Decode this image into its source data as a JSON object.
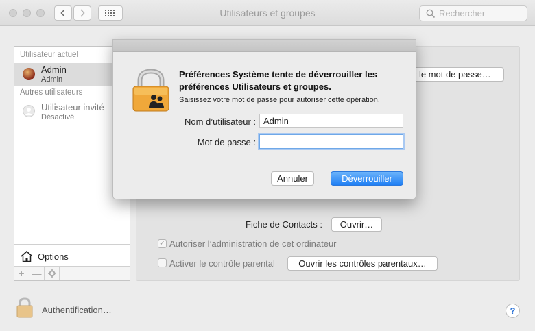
{
  "window": {
    "title": "Utilisateurs et groupes",
    "search_placeholder": "Rechercher"
  },
  "sidebar": {
    "current_user_section": "Utilisateur actuel",
    "current_user": {
      "name": "Admin",
      "role": "Admin"
    },
    "other_users_section": "Autres utilisateurs",
    "guest_user": {
      "name": "Utilisateur invité",
      "status": "Désactivé"
    },
    "options_label": "Options",
    "add_label": "+",
    "remove_label": "—"
  },
  "main": {
    "change_password_button": "r le mot de passe…",
    "contacts_card_label": "Fiche de Contacts :",
    "open_button": "Ouvrir…",
    "allow_admin_label": "Autoriser l’administration de cet ordinateur",
    "allow_admin_checked": true,
    "parental_controls_label": "Activer le contrôle parental",
    "parental_controls_checked": false,
    "open_parental_button": "Ouvrir les contrôles parentaux…"
  },
  "footer": {
    "auth_label": "Authentification…",
    "help_label": "?"
  },
  "dialog": {
    "title": "Préférences Système tente de déverrouiller les préférences Utilisateurs et groupes.",
    "description": "Saisissez votre mot de passe pour autoriser cette opération.",
    "username_label": "Nom d’utilisateur :",
    "username_value": "Admin",
    "password_label": "Mot de passe :",
    "password_value": "",
    "cancel_button": "Annuler",
    "unlock_button": "Déverrouiller",
    "accent_color": "#1f7ff4"
  }
}
